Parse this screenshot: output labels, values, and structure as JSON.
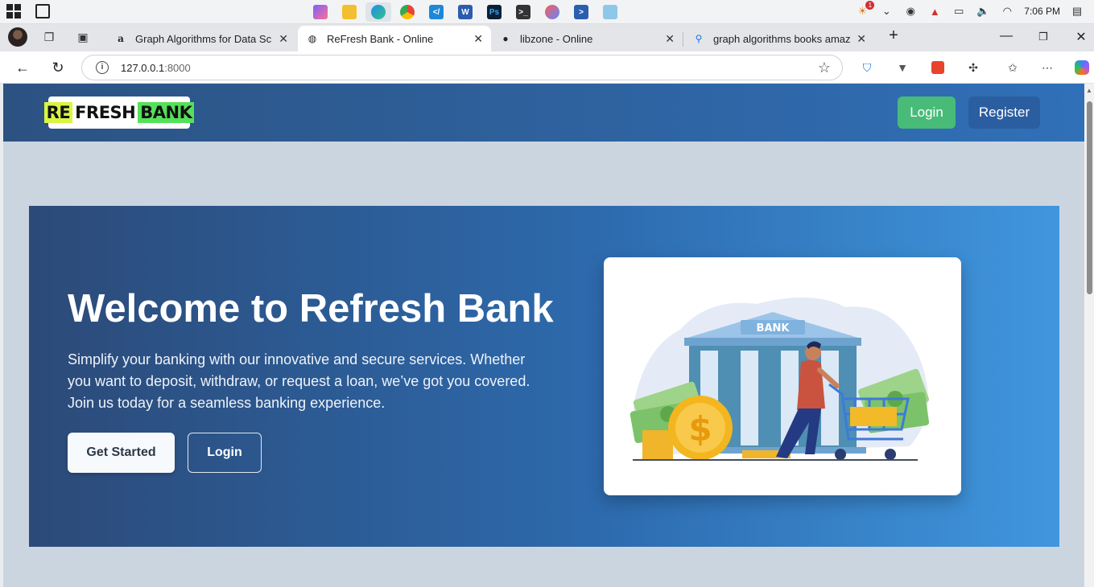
{
  "system": {
    "taskbar_apps": [
      "copilot",
      "file-explorer",
      "edge",
      "chrome",
      "vscode",
      "word",
      "photoshop",
      "terminal",
      "paint",
      "powershell",
      "notepad"
    ],
    "tray": {
      "notification_count": "1",
      "time": "7:06 PM"
    }
  },
  "browser": {
    "tabs": [
      {
        "title": "Graph Algorithms for Data Scienc",
        "favicon": "amazon-icon"
      },
      {
        "title": "ReFresh Bank - Online",
        "favicon": "globe-icon"
      },
      {
        "title": "libzone - Online",
        "favicon": "libzone-icon"
      },
      {
        "title": "graph algorithms books amazon -",
        "favicon": "search-icon"
      }
    ],
    "url_host": "127.0.0.1",
    "url_port": ":8000"
  },
  "site": {
    "logo": {
      "re": "RE",
      "fresh": "FRESH",
      "bank": "BANK"
    },
    "nav": {
      "login": "Login",
      "register": "Register"
    },
    "hero": {
      "title": "Welcome to Refresh Bank",
      "text": "Simplify your banking with our innovative and secure services. Whether you want to deposit, withdraw, or request a loan, we’ve got you covered. Join us today for a seamless banking experience.",
      "get_started": "Get Started",
      "login": "Login"
    },
    "illustration": {
      "bank_sign": "BANK",
      "coin_symbol": "$"
    }
  },
  "colors": {
    "nav_start": "#2c5282",
    "nav_end": "#3070b8",
    "login_green": "#48bb78",
    "register_blue": "#2b5ea0",
    "hero_start": "#2c4a78",
    "hero_end": "#4096de",
    "page_bg": "#cbd5e0"
  }
}
